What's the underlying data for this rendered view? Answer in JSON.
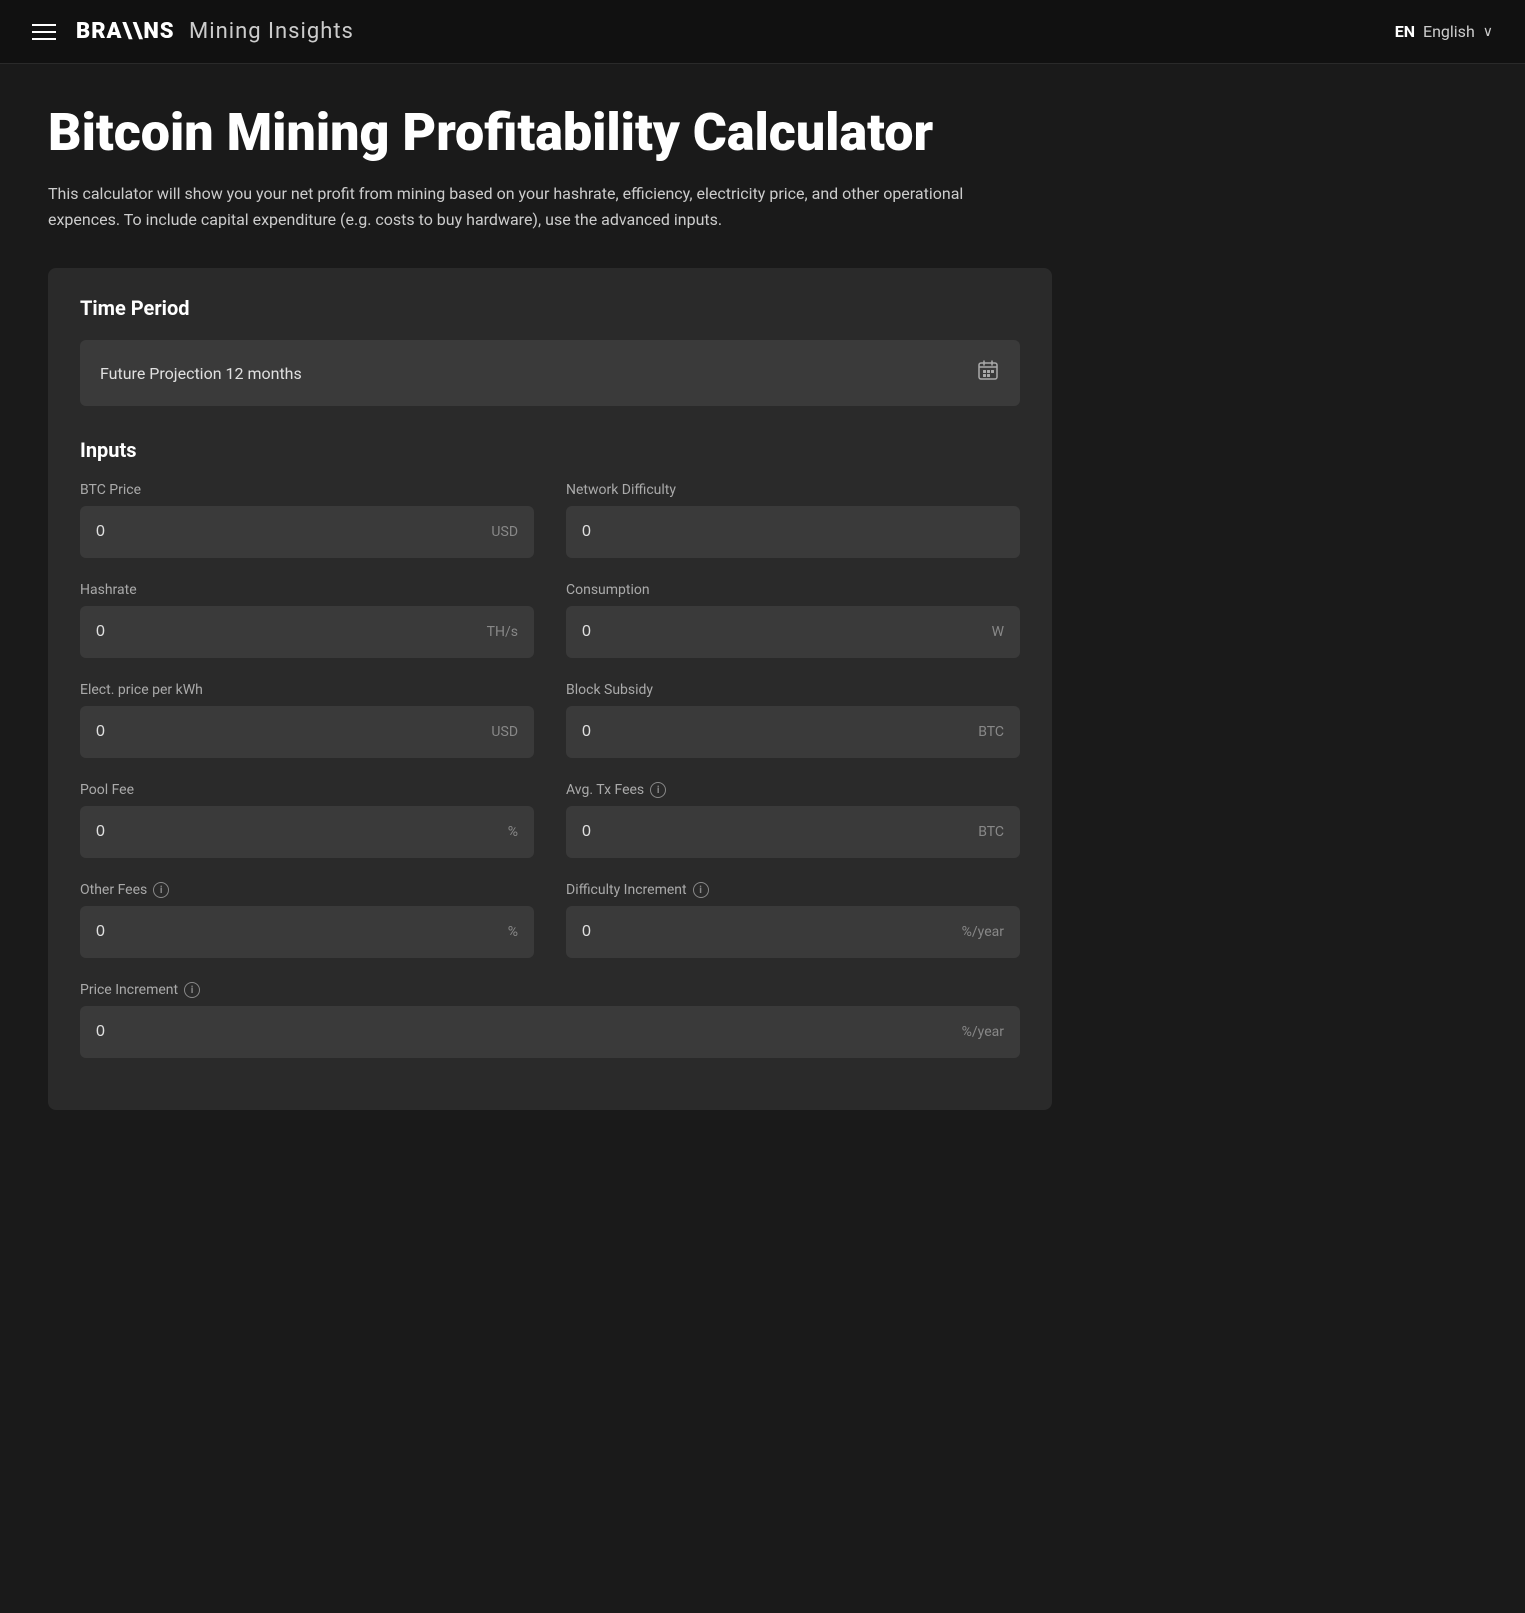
{
  "nav": {
    "menu_label": "Menu",
    "brand": "BRA\\\\NS",
    "subtitle": "Mining Insights",
    "lang_code": "EN",
    "lang_label": "English",
    "chevron": "∨"
  },
  "page": {
    "title": "Bitcoin Mining Profitability Calculator",
    "description": "This calculator will show you your net profit from mining based on your hashrate, efficiency, electricity price, and other operational expences. To include capital expenditure (e.g. costs to buy hardware), use the advanced inputs."
  },
  "time_period": {
    "section_title": "Time Period",
    "selected_label": "Future Projection 12 months",
    "calendar_icon": "📅"
  },
  "inputs": {
    "section_title": "Inputs",
    "fields": [
      {
        "id": "btc-price",
        "label": "BTC Price",
        "value": "0",
        "unit": "USD",
        "has_info": false,
        "col": "left"
      },
      {
        "id": "network-difficulty",
        "label": "Network Difficulty",
        "value": "0",
        "unit": "",
        "has_info": false,
        "col": "right"
      },
      {
        "id": "hashrate",
        "label": "Hashrate",
        "value": "0",
        "unit": "TH/s",
        "has_info": false,
        "col": "left"
      },
      {
        "id": "consumption",
        "label": "Consumption",
        "value": "0",
        "unit": "W",
        "has_info": false,
        "col": "right"
      },
      {
        "id": "elect-price",
        "label": "Elect. price per kWh",
        "value": "0",
        "unit": "USD",
        "has_info": false,
        "col": "left"
      },
      {
        "id": "block-subsidy",
        "label": "Block Subsidy",
        "value": "0",
        "unit": "BTC",
        "has_info": false,
        "col": "right"
      },
      {
        "id": "pool-fee",
        "label": "Pool Fee",
        "value": "0",
        "unit": "%",
        "has_info": false,
        "col": "left"
      },
      {
        "id": "avg-tx-fees",
        "label": "Avg. Tx Fees",
        "value": "0",
        "unit": "BTC",
        "has_info": true,
        "col": "right"
      },
      {
        "id": "other-fees",
        "label": "Other Fees",
        "value": "0",
        "unit": "%",
        "has_info": true,
        "col": "left"
      },
      {
        "id": "difficulty-increment",
        "label": "Difficulty Increment",
        "value": "0",
        "unit": "%/year",
        "has_info": true,
        "col": "right"
      }
    ],
    "full_width_fields": [
      {
        "id": "price-increment",
        "label": "Price Increment",
        "value": "0",
        "unit": "%/year",
        "has_info": true
      }
    ],
    "info_icon_label": "i"
  }
}
